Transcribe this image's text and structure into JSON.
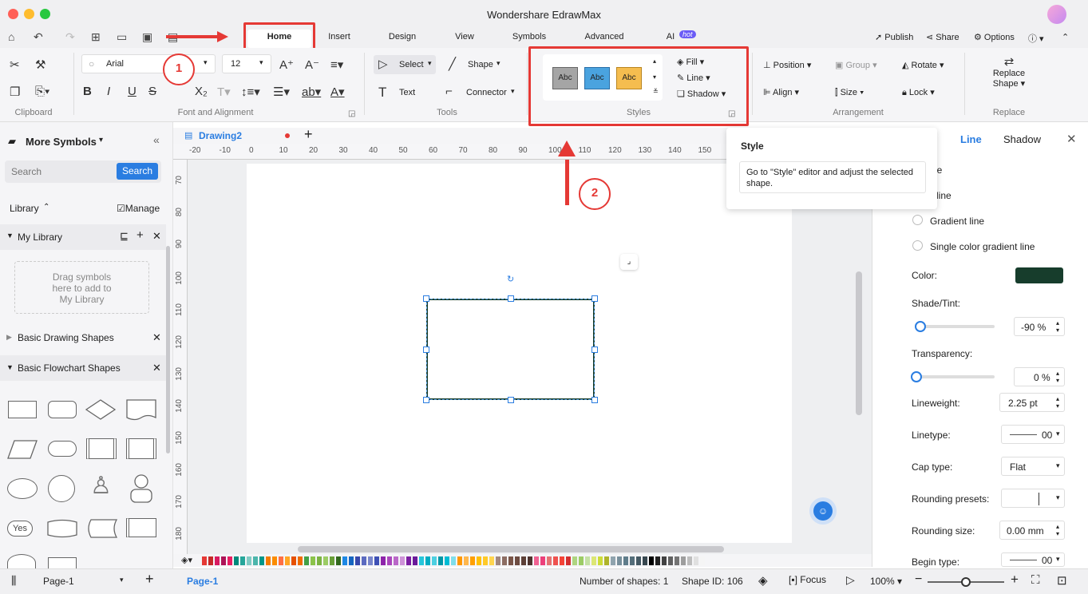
{
  "app": {
    "title": "Wondershare EdrawMax"
  },
  "menu": {
    "tabs": [
      "Home",
      "Insert",
      "Design",
      "View",
      "Symbols",
      "Advanced",
      "AI"
    ],
    "hot_badge": "hot",
    "publish": "Publish",
    "share": "Share",
    "options": "Options"
  },
  "ribbon": {
    "clipboard": "Clipboard",
    "font_group": "Font and Alignment",
    "tools_group": "Tools",
    "styles_group": "Styles",
    "arrange_group": "Arrangement",
    "replace_group": "Replace",
    "font_name": "Arial",
    "font_size": "12",
    "select": "Select",
    "shape": "Shape",
    "text": "Text",
    "connector": "Connector",
    "style_swatch": "Abc",
    "fill": "Fill",
    "line": "Line",
    "shadow": "Shadow",
    "position": "Position",
    "group": "Group",
    "rotate": "Rotate",
    "align": "Align",
    "size": "Size",
    "lock": "Lock",
    "replace_shape_1": "Replace",
    "replace_shape_2": "Shape",
    "styles_colors": [
      "#a5a5a5",
      "#4aa3df",
      "#f5bd4f"
    ]
  },
  "annotations": {
    "step1": "1",
    "step2": "2"
  },
  "left": {
    "title": "More Symbols",
    "search_placeholder": "Search",
    "search_btn": "Search",
    "library": "Library",
    "manage": "Manage",
    "my_library": "My Library",
    "drag_hint": "Drag symbols here to add to My Library",
    "basic_drawing": "Basic Drawing Shapes",
    "basic_flowchart": "Basic Flowchart Shapes",
    "yes_shape": "Yes"
  },
  "canvas": {
    "tab": "Drawing2",
    "ruler_top": [
      "-20",
      "-10",
      "0",
      "10",
      "20",
      "30",
      "40",
      "50",
      "60",
      "70",
      "80",
      "90",
      "100",
      "110",
      "120",
      "130",
      "140",
      "150"
    ],
    "ruler_left": [
      "70",
      "80",
      "90",
      "100",
      "110",
      "120",
      "130",
      "140",
      "150",
      "160",
      "170",
      "180"
    ]
  },
  "tooltip": {
    "title": "Style",
    "body": "Go to \"Style\" editor and adjust the selected shape."
  },
  "right": {
    "tab_line": "Line",
    "tab_shadow": "Shadow",
    "no_line": "No line",
    "solid_line": "Solid line",
    "gradient_line": "Gradient line",
    "single_gradient": "Single color gradient line",
    "color": "Color:",
    "color_value": "#173d2c",
    "shade": "Shade/Tint:",
    "shade_value": "-90 %",
    "shade_fraction": 0.05,
    "transparency": "Transparency:",
    "transparency_value": "0 %",
    "transparency_fraction": 0,
    "lineweight": "Lineweight:",
    "lineweight_value": "2.25 pt",
    "linetype": "Linetype:",
    "linetype_value": "00",
    "cap": "Cap type:",
    "cap_value": "Flat",
    "rounding_presets": "Rounding presets:",
    "rounding_size": "Rounding size:",
    "rounding_value": "0.00 mm",
    "begin_type": "Begin type:",
    "begin_value": "00"
  },
  "status": {
    "page_select": "Page-1",
    "page_tab": "Page-1",
    "shapes": "Number of shapes: 1",
    "shape_id": "Shape ID: 106",
    "focus": "Focus",
    "zoom": "100%",
    "zoom_fraction": 0.5
  },
  "palette": [
    "#e53935",
    "#c62828",
    "#d81b60",
    "#ad1457",
    "#e91e63",
    "#00897b",
    "#26a69a",
    "#80cbc4",
    "#4db6ac",
    "#009688",
    "#f57c00",
    "#fb8c00",
    "#ff7043",
    "#ffa726",
    "#e65100",
    "#ef6c00",
    "#43a047",
    "#8bc34a",
    "#7cb342",
    "#9ccc65",
    "#689f38",
    "#33691e",
    "#1e88e5",
    "#1565c0",
    "#3949ab",
    "#5c6bc0",
    "#7986cb",
    "#3f51b5",
    "#8e24aa",
    "#ab47bc",
    "#ba68c8",
    "#ce93d8",
    "#7b1fa2",
    "#6a1b9a",
    "#26c6da",
    "#00acc1",
    "#4dd0e1",
    "#0097a7",
    "#00bcd4",
    "#80deea",
    "#ff9800",
    "#ffb74d",
    "#ffa000",
    "#ffc107",
    "#ffca28",
    "#ffd54f",
    "#a1887f",
    "#8d6e63",
    "#795548",
    "#6d4c41",
    "#5d4037",
    "#4e342e",
    "#f06292",
    "#ec407a",
    "#e57373",
    "#ef5350",
    "#f44336",
    "#d32f2f",
    "#aed581",
    "#9ccc65",
    "#c5e1a5",
    "#dce775",
    "#cddc39",
    "#afb42b",
    "#90a4ae",
    "#78909c",
    "#607d8b",
    "#546e7a",
    "#455a64",
    "#37474f",
    "#000000",
    "#212121",
    "#424242",
    "#616161",
    "#757575",
    "#9e9e9e",
    "#bdbdbd",
    "#e0e0e0",
    "#f5f5f5"
  ]
}
